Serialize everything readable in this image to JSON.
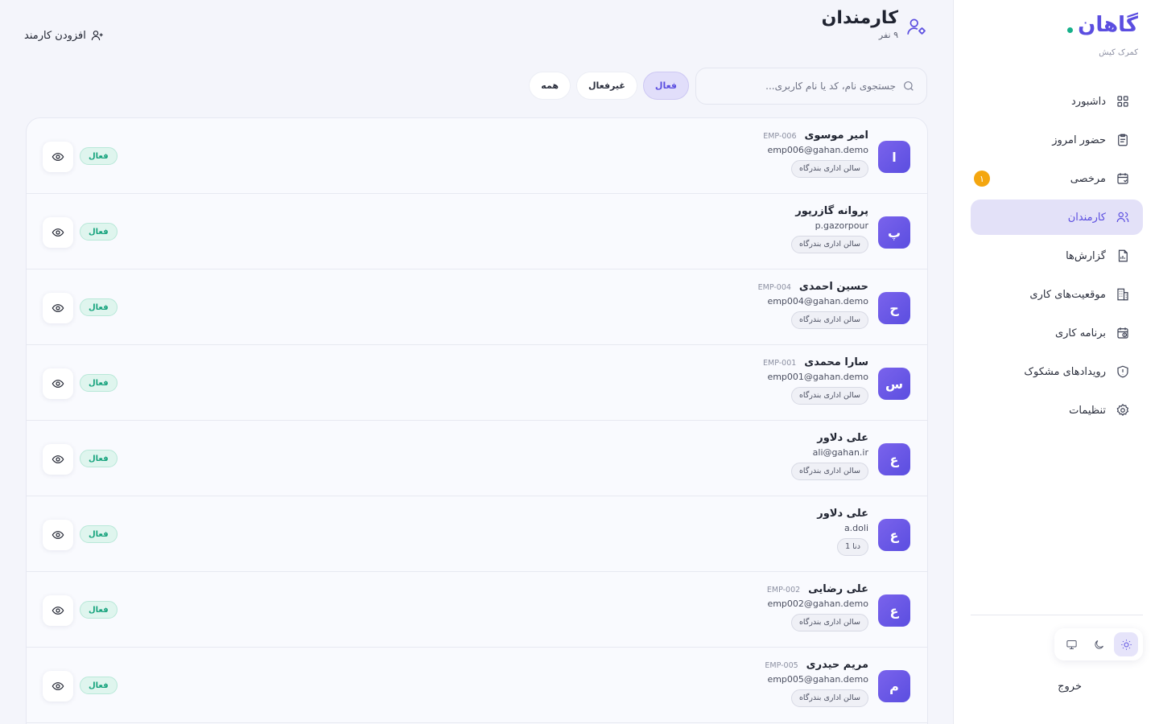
{
  "sidebar": {
    "brand_title": "گاهان",
    "brand_subtitle": "کمرک کیش",
    "items": [
      {
        "label": "داشبورد",
        "icon": "dashboard-icon",
        "active": false
      },
      {
        "label": "حضور امروز",
        "icon": "clipboard-icon",
        "active": false
      },
      {
        "label": "مرخصی",
        "icon": "calendar-icon",
        "active": false,
        "badge": "۱"
      },
      {
        "label": "کارمندان",
        "icon": "users-icon",
        "active": true
      },
      {
        "label": "گزارش‌ها",
        "icon": "report-icon",
        "active": false
      },
      {
        "label": "موقعیت‌های کاری",
        "icon": "building-icon",
        "active": false
      },
      {
        "label": "برنامه کاری",
        "icon": "schedule-icon",
        "active": false
      },
      {
        "label": "رویدادهای مشکوک",
        "icon": "shield-icon",
        "active": false
      },
      {
        "label": "تنظیمات",
        "icon": "gear-icon",
        "active": false
      }
    ],
    "theme_options": [
      "sun-icon",
      "moon-icon",
      "monitor-icon"
    ],
    "logout_label": "خروج"
  },
  "header": {
    "title": "کارمندان",
    "count": "۹ نفر",
    "add_label": "افزودن کارمند"
  },
  "filters": {
    "search_placeholder": "جستجوی نام، کد یا نام کاربری...",
    "chips": [
      {
        "label": "فعال",
        "active": true
      },
      {
        "label": "غیرفعال",
        "active": false
      },
      {
        "label": "همه",
        "active": false
      }
    ]
  },
  "employees": [
    {
      "initial": "ا",
      "name": "امیر موسوی",
      "code": "EMP-006",
      "username": "emp006@gahan.demo",
      "location": "سالن اداری بندرگاه",
      "status": "فعال"
    },
    {
      "initial": "پ",
      "name": "پروانه گازرپور",
      "code": "",
      "username": "p.gazorpour",
      "location": "سالن اداری بندرگاه",
      "status": "فعال"
    },
    {
      "initial": "ح",
      "name": "حسین احمدی",
      "code": "EMP-004",
      "username": "emp004@gahan.demo",
      "location": "سالن اداری بندرگاه",
      "status": "فعال"
    },
    {
      "initial": "س",
      "name": "سارا محمدی",
      "code": "EMP-001",
      "username": "emp001@gahan.demo",
      "location": "سالن اداری بندرگاه",
      "status": "فعال"
    },
    {
      "initial": "ع",
      "name": "علی دلاور",
      "code": "",
      "username": "ali@gahan.ir",
      "location": "سالن اداری بندرگاه",
      "status": "فعال"
    },
    {
      "initial": "ع",
      "name": "علی دلاور",
      "code": "",
      "username": "a.doli",
      "location": "دنا 1",
      "status": "فعال"
    },
    {
      "initial": "ع",
      "name": "علی رضایی",
      "code": "EMP-002",
      "username": "emp002@gahan.demo",
      "location": "سالن اداری بندرگاه",
      "status": "فعال"
    },
    {
      "initial": "م",
      "name": "مریم حیدری",
      "code": "EMP-005",
      "username": "emp005@gahan.demo",
      "location": "سالن اداری بندرگاه",
      "status": "فعال"
    }
  ],
  "colors": {
    "accent": "#5b4ee0",
    "success": "#16a37d",
    "badge": "#f4a60f"
  }
}
